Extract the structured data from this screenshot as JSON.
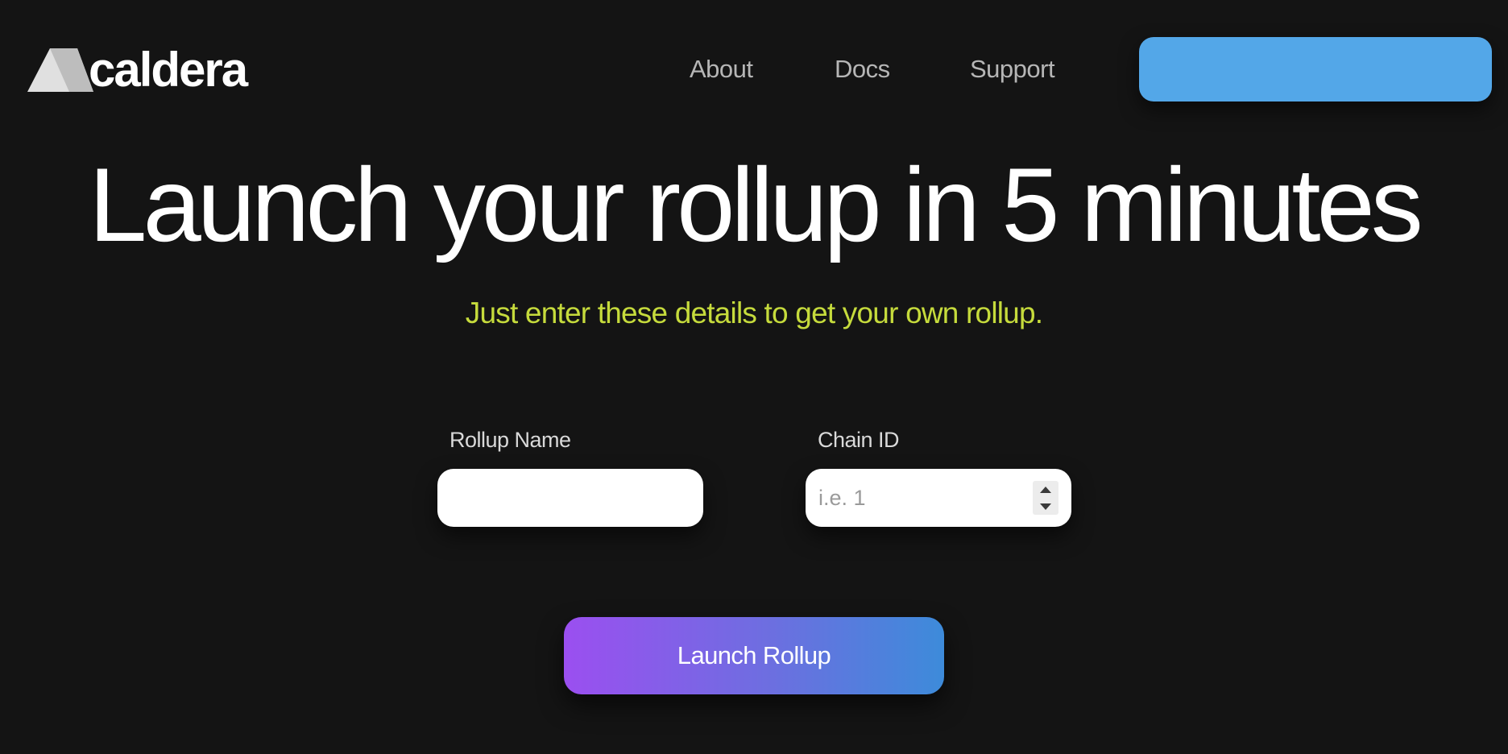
{
  "header": {
    "logo_text": "caldera",
    "nav": {
      "about": "About",
      "docs": "Docs",
      "support": "Support"
    },
    "cta_label": ""
  },
  "hero": {
    "title": "Launch your rollup in 5 minutes",
    "subtitle": "Just enter these details to get your own rollup."
  },
  "form": {
    "rollup_name": {
      "label": "Rollup Name",
      "value": "",
      "placeholder": ""
    },
    "chain_id": {
      "label": "Chain ID",
      "value": "",
      "placeholder": "i.e. 1"
    },
    "submit_label": "Launch Rollup"
  },
  "colors": {
    "background": "#141414",
    "accent_blue": "#53a7e8",
    "subtitle_lime": "#c6db3c",
    "gradient_start": "#9b4ff0",
    "gradient_end": "#3d8bda"
  },
  "icons": {
    "logo": "caldera-mountain-icon",
    "spinner_up": "chevron-up-icon",
    "spinner_down": "chevron-down-icon"
  }
}
